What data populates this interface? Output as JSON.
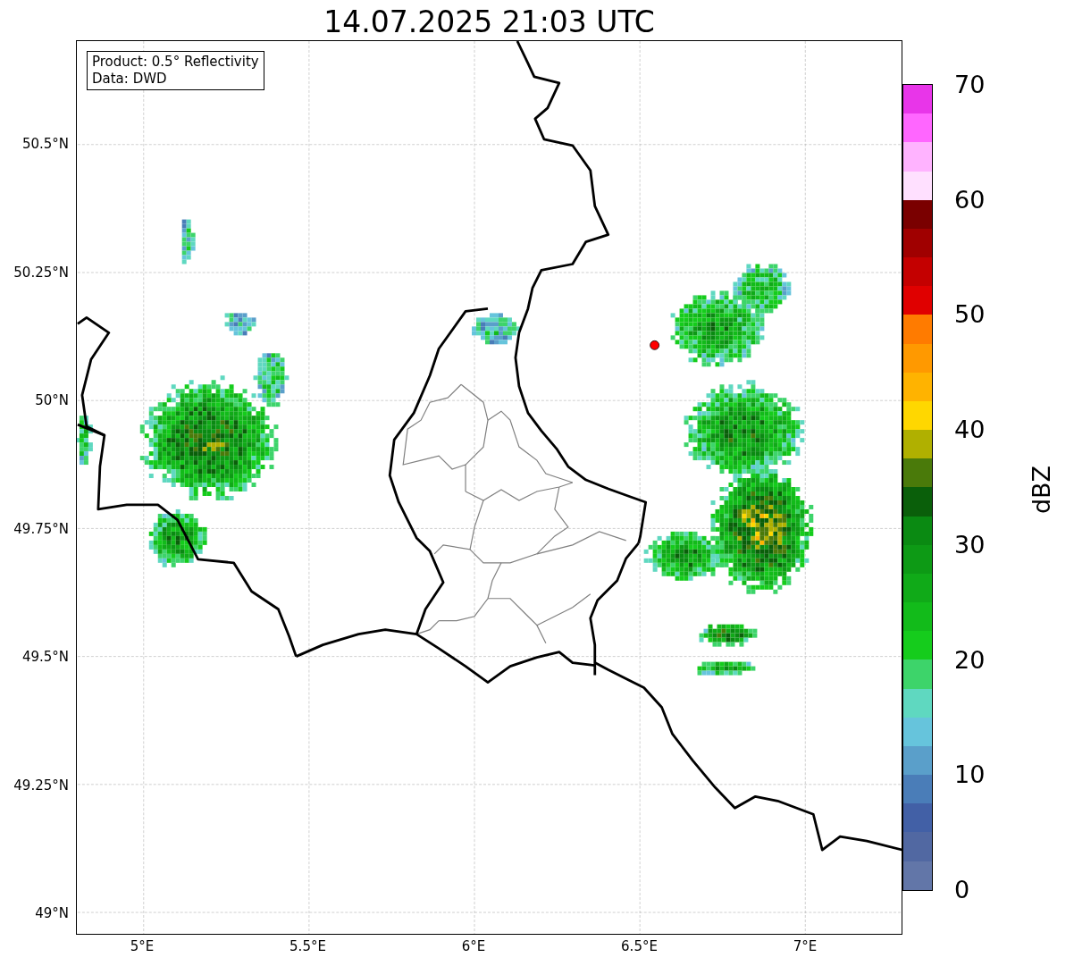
{
  "title": "14.07.2025 21:03 UTC",
  "legend": [
    "Product: 0.5° Reflectivity",
    "Data: DWD"
  ],
  "lat_ticks": [
    "50.5°N",
    "50.25°N",
    "50°N",
    "49.75°N",
    "49.5°N",
    "49.25°N",
    "49°N"
  ],
  "lon_ticks": [
    "5°E",
    "5.5°E",
    "6°E",
    "6.5°E",
    "7°E"
  ],
  "colorbar": {
    "label": "dBZ",
    "ticks": [
      "70",
      "60",
      "50",
      "40",
      "30",
      "20",
      "10",
      "0"
    ],
    "bins": [
      {
        "color": "#e835e9"
      },
      {
        "color": "#ff66ff"
      },
      {
        "color": "#ffb3ff"
      },
      {
        "color": "#ffe0ff"
      },
      {
        "color": "#7a0000"
      },
      {
        "color": "#a00000"
      },
      {
        "color": "#c40000"
      },
      {
        "color": "#e00000"
      },
      {
        "color": "#ff7b00"
      },
      {
        "color": "#ff9900"
      },
      {
        "color": "#ffb300"
      },
      {
        "color": "#ffd700"
      },
      {
        "color": "#b0b000"
      },
      {
        "color": "#4a7a0a"
      },
      {
        "color": "#0a5f0a"
      },
      {
        "color": "#0a8a12"
      },
      {
        "color": "#0d9a15"
      },
      {
        "color": "#10aa18"
      },
      {
        "color": "#12bb1a"
      },
      {
        "color": "#15cc1c"
      },
      {
        "color": "#3dd46a"
      },
      {
        "color": "#5fd8c0"
      },
      {
        "color": "#66c4dc"
      },
      {
        "color": "#5a9fca"
      },
      {
        "color": "#4a7db8"
      },
      {
        "color": "#4260a6"
      },
      {
        "color": "#5168a2"
      },
      {
        "color": "#6276a8"
      }
    ]
  }
}
